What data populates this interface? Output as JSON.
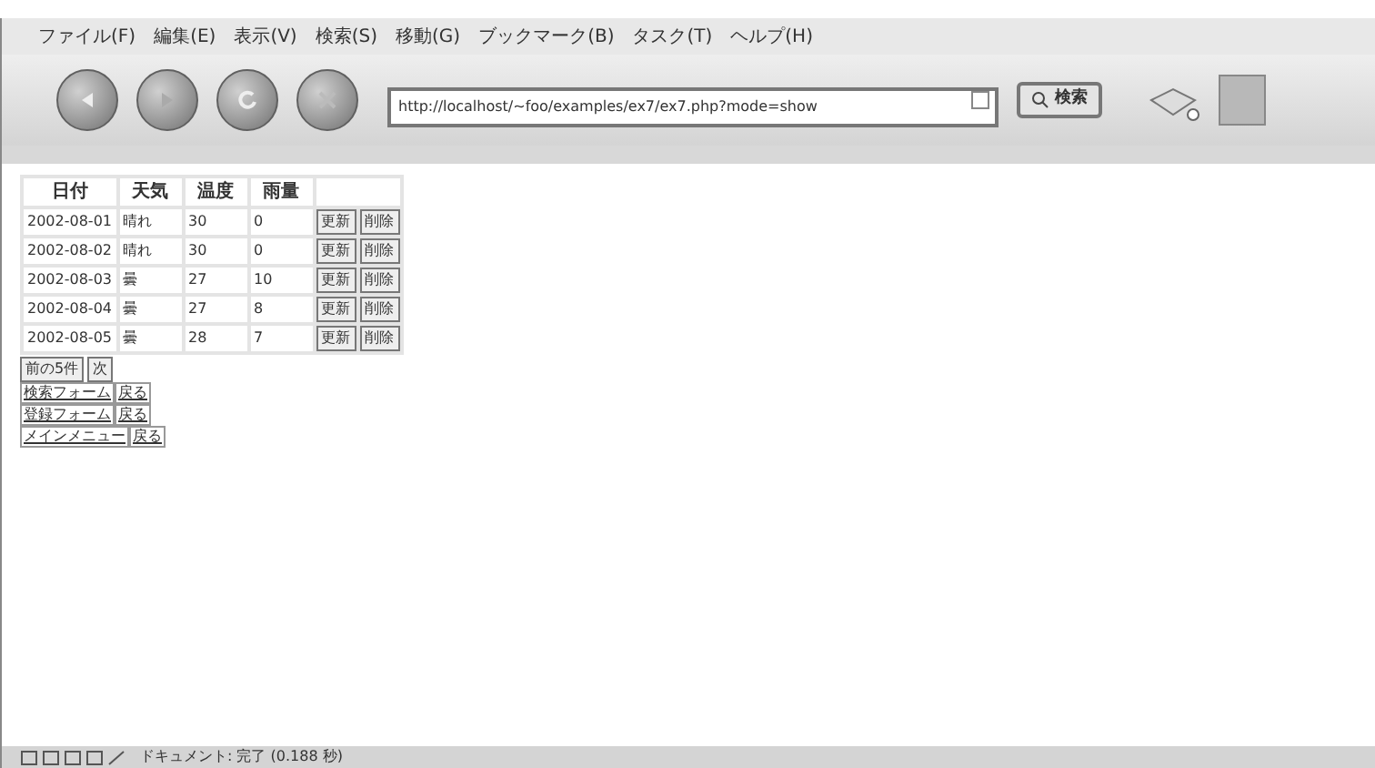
{
  "menu": [
    "ファイル(F)",
    "編集(E)",
    "表示(V)",
    "検索(S)",
    "移動(G)",
    "ブックマーク(B)",
    "タスク(T)",
    "ヘルプ(H)"
  ],
  "address": {
    "value": "http://localhost/~foo/examples/ex7/ex7.php?mode=show"
  },
  "search_button": "検索",
  "table": {
    "columns": [
      "日付",
      "天気",
      "温度",
      "雨量"
    ],
    "rows": [
      {
        "cells": [
          "2002-08-01",
          "晴れ",
          "30",
          "0"
        ],
        "buttons": [
          "更新",
          "削除"
        ]
      },
      {
        "cells": [
          "2002-08-02",
          "晴れ",
          "30",
          "0"
        ],
        "buttons": [
          "更新",
          "削除"
        ]
      },
      {
        "cells": [
          "2002-08-03",
          "曇",
          "27",
          "10"
        ],
        "buttons": [
          "更新",
          "削除"
        ]
      },
      {
        "cells": [
          "2002-08-04",
          "曇",
          "27",
          "8"
        ],
        "buttons": [
          "更新",
          "削除"
        ]
      },
      {
        "cells": [
          "2002-08-05",
          "曇",
          "28",
          "7"
        ],
        "buttons": [
          "更新",
          "削除"
        ]
      }
    ]
  },
  "pager": [
    "前の5件",
    "次"
  ],
  "links": [
    [
      "検索フォーム",
      "戻る"
    ],
    [
      "登録フォーム",
      "戻る"
    ],
    [
      "メインメニュー",
      "戻る"
    ]
  ],
  "status_bar": "ドキュメント: 完了 (0.188 秒)"
}
